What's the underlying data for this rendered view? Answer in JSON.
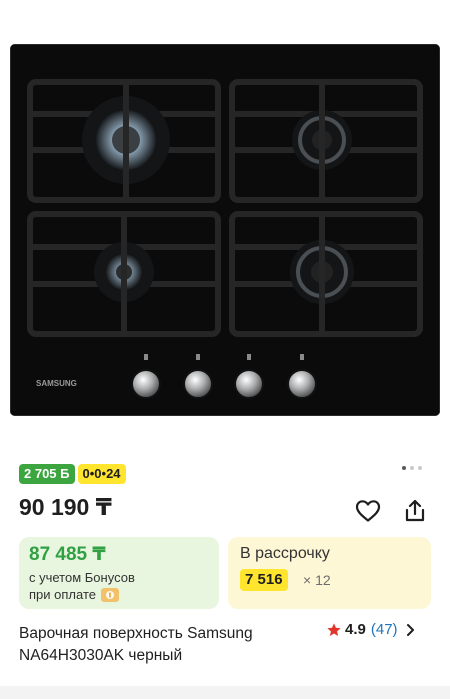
{
  "product_image": {
    "brand_logo_text": "SAMSUNG",
    "icon": "gas-hob-photo"
  },
  "badges": {
    "bonus": "2 705 Б",
    "installment": "0•0•24"
  },
  "carousel": {
    "total": 3,
    "active_index": 0
  },
  "price": {
    "current": "90 190 ₸"
  },
  "actions": {
    "favorite_icon": "heart-icon",
    "share_icon": "share-icon"
  },
  "bonus_card": {
    "price": "87 485 ₸",
    "line1": "с учетом Бонусов",
    "line2": "при оплате",
    "icon": "coin-icon"
  },
  "installment_card": {
    "title": "В рассрочку",
    "amount": "7 516",
    "months": "× 12"
  },
  "product": {
    "title": "Варочная поверхность Samsung NA64H3030AK черный",
    "rating": "4.9",
    "reviews": "(47)"
  },
  "colors": {
    "green_accent": "#3da53f",
    "green_price": "#2fa043",
    "yellow_accent": "#ffe52e",
    "link_blue": "#1e73be",
    "star_red": "#e0352b"
  }
}
